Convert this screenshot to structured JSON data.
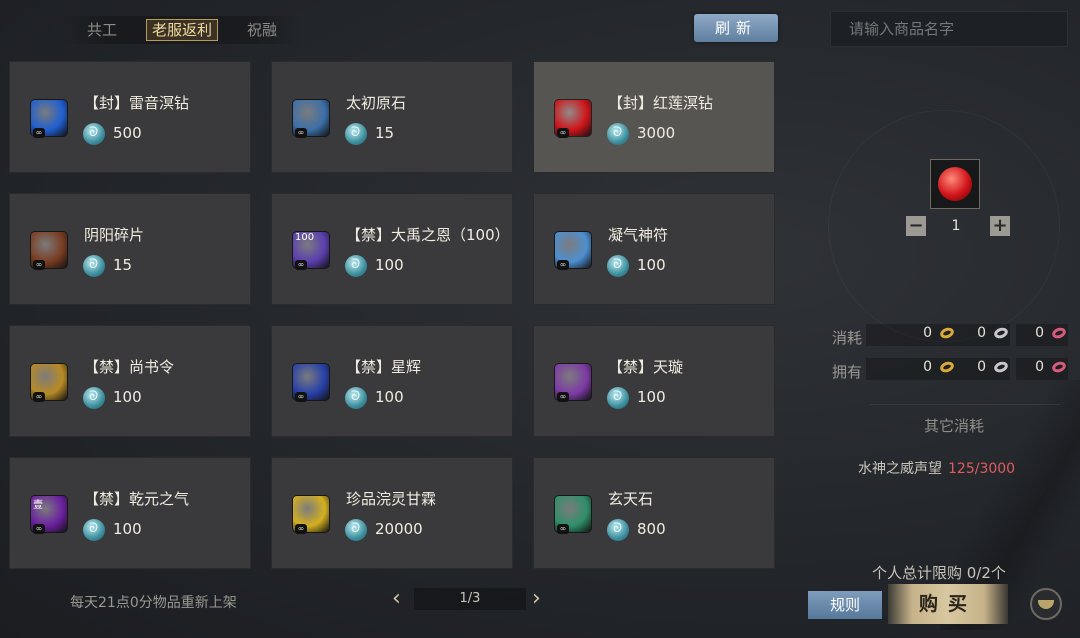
{
  "tabs": [
    {
      "label": "共工",
      "active": false
    },
    {
      "label": "老服返利",
      "active": true
    },
    {
      "label": "祝融",
      "active": false
    }
  ],
  "refresh_label": "刷新",
  "search": {
    "placeholder": "请输入商品名字"
  },
  "items": [
    {
      "name": "【封】雷音溟钻",
      "price": "500",
      "icon": "blue-orb-icon",
      "color": "#1f5fd0",
      "selected": false
    },
    {
      "name": "太初原石",
      "price": "15",
      "icon": "stone-icon",
      "color": "#3b6fa8",
      "selected": false
    },
    {
      "name": "【封】红莲溟钻",
      "price": "3000",
      "icon": "red-gem-icon",
      "color": "#d0141a",
      "selected": true
    },
    {
      "name": "阴阳碎片",
      "price": "15",
      "icon": "shard-icon",
      "color": "#7a3d22",
      "selected": false
    },
    {
      "name": "【禁】大禹之恩（100）",
      "price": "100",
      "icon": "token-100-icon",
      "color": "#5b3fb0",
      "selected": false,
      "badge": "100"
    },
    {
      "name": "凝气神符",
      "price": "100",
      "icon": "talisman-icon",
      "color": "#4d8fd0",
      "selected": false
    },
    {
      "name": "【禁】尚书令",
      "price": "100",
      "icon": "gold-seal-icon",
      "color": "#b88a25",
      "selected": false
    },
    {
      "name": "【禁】星辉",
      "price": "100",
      "icon": "star-icon",
      "color": "#2841a8",
      "selected": false
    },
    {
      "name": "【禁】天璇",
      "price": "100",
      "icon": "crystal-icon",
      "color": "#7d3aa5",
      "selected": false
    },
    {
      "name": "【禁】乾元之气",
      "price": "100",
      "icon": "purple-qi-icon",
      "color": "#6a20a0",
      "selected": false,
      "badge": "壹"
    },
    {
      "name": "珍品浣灵甘霖",
      "price": "20000",
      "icon": "gold-orb-icon",
      "color": "#d4b020",
      "selected": false
    },
    {
      "name": "玄天石",
      "price": "800",
      "icon": "green-stone-icon",
      "color": "#2f8f6a",
      "selected": false
    }
  ],
  "quantity": "1",
  "cost_label": "消耗",
  "owned_label": "拥有",
  "cost_values": [
    "0",
    "0",
    "0"
  ],
  "owned_values": [
    "0",
    "0",
    "0"
  ],
  "currency_colors": [
    "#d9a93a",
    "#c8c8cc",
    "#d85c7a"
  ],
  "other_cost_label": "其它消耗",
  "reputation": {
    "label": "水神之威声望",
    "value": "125/3000"
  },
  "limit_text": "个人总计限购 0/2个",
  "rules_label": "规则",
  "buy_label": "购买",
  "restock_note": "每天21点0分物品重新上架",
  "page": "1/3"
}
